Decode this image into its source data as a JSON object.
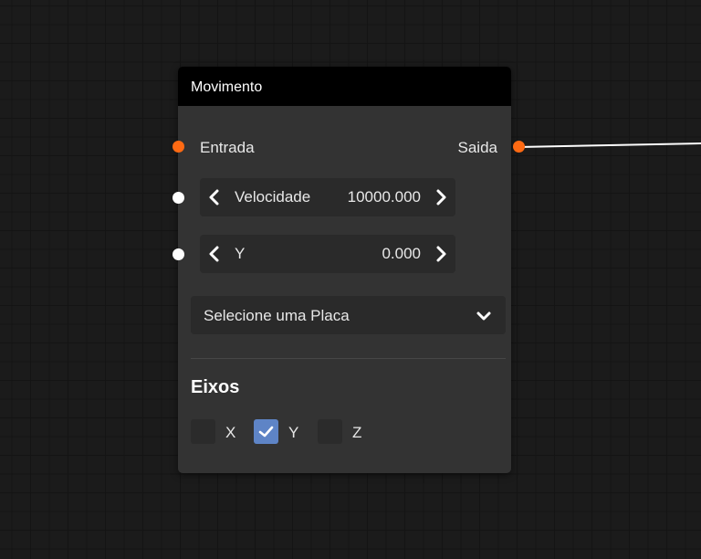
{
  "node": {
    "title": "Movimento",
    "input_label": "Entrada",
    "output_label": "Saida",
    "params": [
      {
        "name": "Velocidade",
        "value": "10000.000"
      },
      {
        "name": "Y",
        "value": "0.000"
      }
    ],
    "select_placeholder": "Selecione uma Placa",
    "axes": {
      "title": "Eixos",
      "items": [
        {
          "label": "X",
          "checked": false
        },
        {
          "label": "Y",
          "checked": true
        },
        {
          "label": "Z",
          "checked": false
        }
      ]
    }
  },
  "icons": {
    "exec_pin": "orange-circle",
    "param_pin": "white-circle",
    "decrement": "chevron-left-icon",
    "increment": "chevron-right-icon",
    "dropdown": "chevron-down-icon",
    "check": "checkmark-icon"
  },
  "colors": {
    "canvas": "#1b1b1b",
    "node_body": "#333333",
    "node_header": "#000000",
    "pin_exec": "#ff6a13",
    "pin_param": "#ffffff",
    "checkbox_checked": "#5e84c6",
    "wire": "#ffffff"
  }
}
